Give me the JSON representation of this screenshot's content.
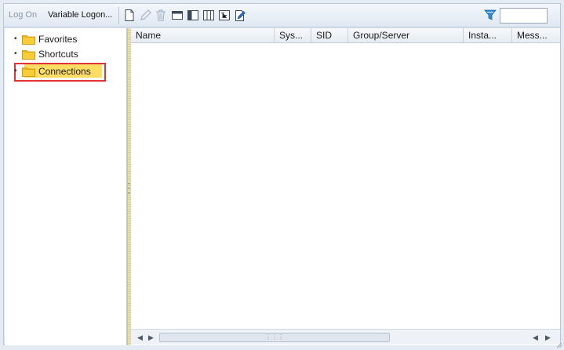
{
  "toolbar": {
    "log_on_label": "Log On",
    "variable_logon_label": "Variable Logon...",
    "icons": [
      "new-entry-icon",
      "edit-icon",
      "delete-icon",
      "view-icon",
      "list-view-icon",
      "tile-view-icon",
      "tree-view-icon",
      "properties-icon"
    ],
    "filter_icon": "filter-icon",
    "filter_value": ""
  },
  "tree": {
    "items": [
      {
        "label": "Favorites",
        "icon": "folder-icon"
      },
      {
        "label": "Shortcuts",
        "icon": "folder-icon"
      },
      {
        "label": "Connections",
        "icon": "folder-icon",
        "selected": true
      }
    ]
  },
  "list": {
    "columns": [
      "Name",
      "Sys...",
      "SID",
      "Group/Server",
      "Insta...",
      "Mess..."
    ],
    "rows": []
  },
  "colors": {
    "selection_fill": "#ffdc62",
    "highlight_border": "#e0343a",
    "folder": "#f2b90f"
  }
}
